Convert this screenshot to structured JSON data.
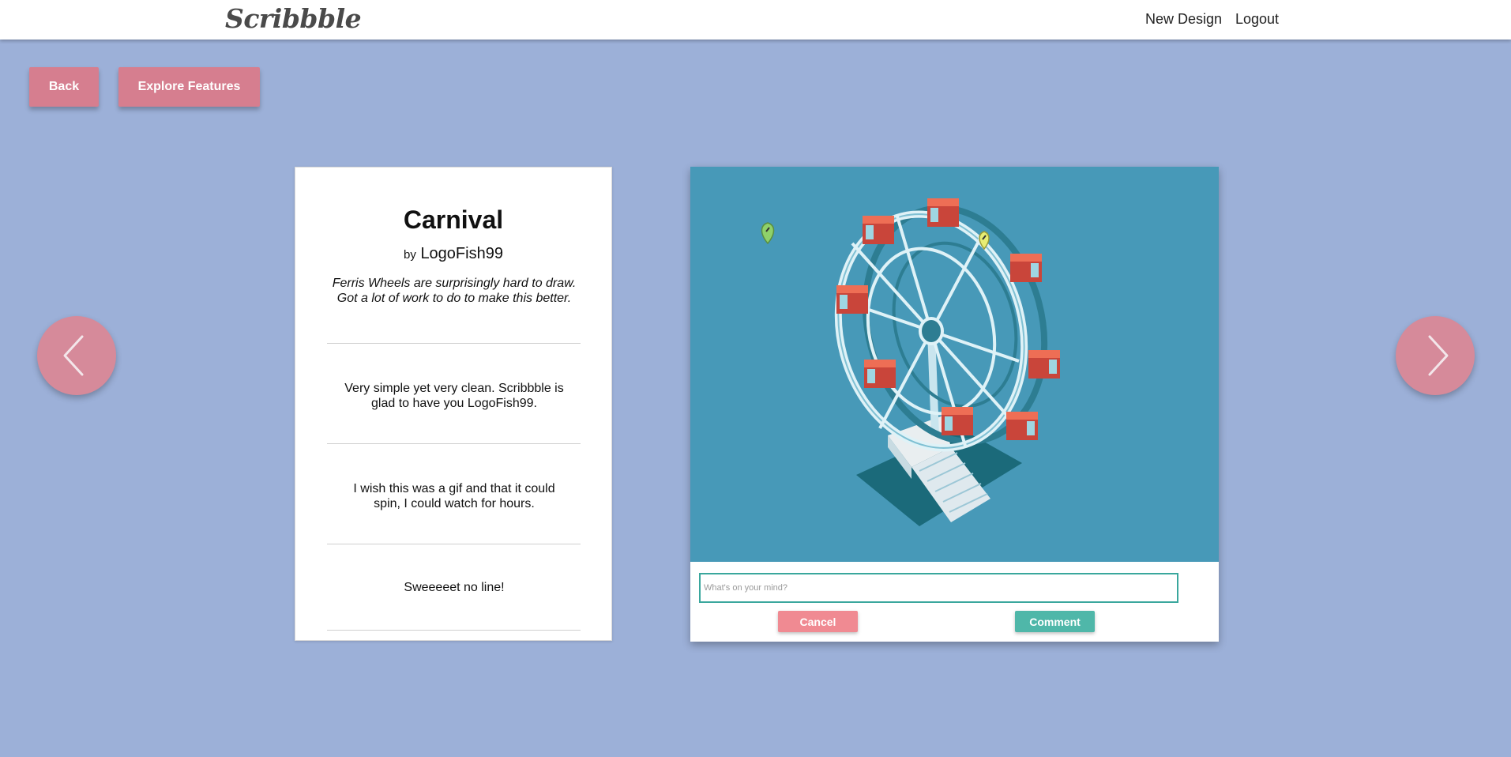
{
  "navbar": {
    "logo": "Scribbble",
    "links": [
      {
        "label": "New Design"
      },
      {
        "label": "Logout"
      }
    ]
  },
  "actions": {
    "back_label": "Back",
    "explore_label": "Explore Features"
  },
  "arrows": {
    "left_icon": "chevron-left-icon",
    "right_icon": "chevron-right-icon"
  },
  "design": {
    "title": "Carnival",
    "by_label": "by",
    "author": "LogoFish99",
    "description": "Ferris Wheels are surprisingly hard to draw. Got a lot of work to do to make this better.",
    "image_subject": "ferris-wheel-illustration",
    "pins": [
      {
        "color": "#8fd16a",
        "icon": "map-pin-icon"
      },
      {
        "color": "#e8ee74",
        "icon": "map-pin-icon"
      }
    ]
  },
  "comments": [
    {
      "text": "Very simple yet very clean. Scribbble is glad to have you LogoFish99."
    },
    {
      "text": "I wish this was a gif and that it could spin, I could watch for hours."
    },
    {
      "text": "Sweeeeet no line!"
    }
  ],
  "comment_form": {
    "placeholder": "What's on your mind?",
    "value": "",
    "cancel_label": "Cancel",
    "comment_label": "Comment"
  },
  "colors": {
    "background": "#9cb0d8",
    "button_pink": "#d67e8f",
    "cancel": "#f08a92",
    "comment": "#4fb7a9",
    "image_bg": "#4799b8"
  }
}
